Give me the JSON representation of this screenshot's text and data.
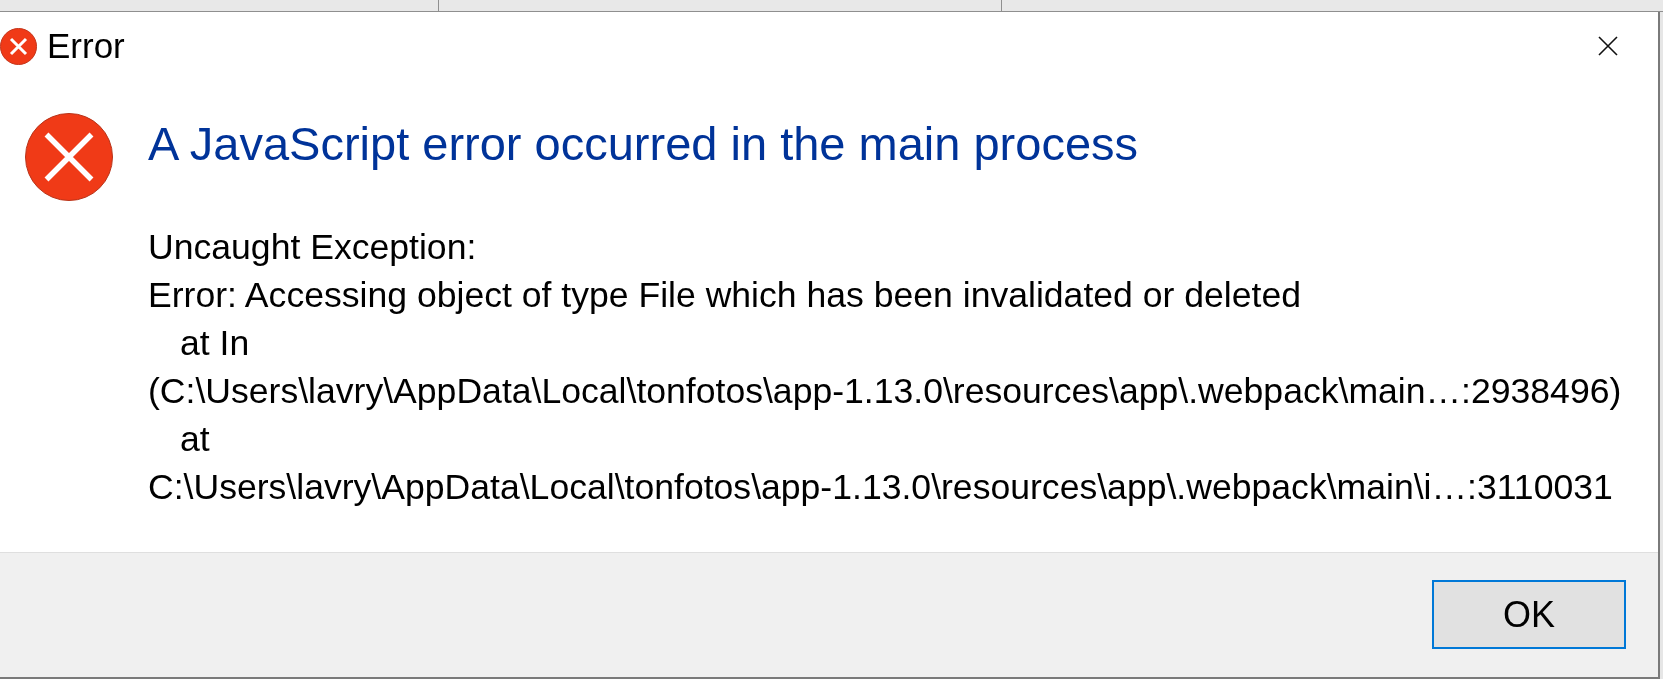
{
  "window": {
    "title": "Error"
  },
  "dialog": {
    "heading": "A JavaScript error occurred in the main process",
    "message_lines": [
      "Uncaught Exception:",
      "Error: Accessing object of type File which has been invalidated or deleted"
    ],
    "stack_frames": [
      {
        "label": "at In",
        "location": "(C:\\Users\\lavry\\AppData\\Local\\tonfotos\\app-1.13.0\\resources\\app\\.webpack\\main…:2938496)"
      },
      {
        "label": "at",
        "location": "C:\\Users\\lavry\\AppData\\Local\\tonfotos\\app-1.13.0\\resources\\app\\.webpack\\main\\i…:3110031"
      }
    ],
    "buttons": [
      {
        "label": "OK",
        "focused": true
      }
    ]
  }
}
